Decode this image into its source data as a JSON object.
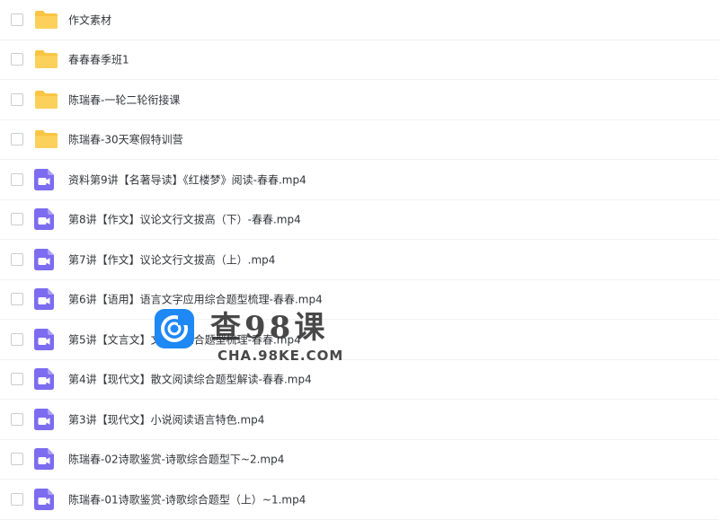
{
  "files": [
    {
      "type": "folder",
      "name": "作文素材"
    },
    {
      "type": "folder",
      "name": "春春春季班1"
    },
    {
      "type": "folder",
      "name": "陈瑞春-一轮二轮衔接课"
    },
    {
      "type": "folder",
      "name": "陈瑞春-30天寒假特训营"
    },
    {
      "type": "video",
      "name": "资料第9讲【名著导读】《红楼梦》阅读-春春.mp4"
    },
    {
      "type": "video",
      "name": "第8讲【作文】议论文行文拔高（下）-春春.mp4"
    },
    {
      "type": "video",
      "name": "第7讲【作文】议论文行文拔高（上）.mp4"
    },
    {
      "type": "video",
      "name": "第6讲【语用】语言文字应用综合题型梳理-春春.mp4"
    },
    {
      "type": "video",
      "name": "第5讲【文言文】文言文综合题型梳理-春春.mp4"
    },
    {
      "type": "video",
      "name": "第4讲【现代文】散文阅读综合题型解读-春春.mp4"
    },
    {
      "type": "video",
      "name": "第3讲【现代文】小说阅读语言特色.mp4"
    },
    {
      "type": "video",
      "name": "陈瑞春-02诗歌鉴赏-诗歌综合题型下~2.mp4"
    },
    {
      "type": "video",
      "name": "陈瑞春-01诗歌鉴赏-诗歌综合题型（上）~1.mp4"
    }
  ],
  "icons": {
    "folder": "folder-icon",
    "video": "video-file-icon"
  },
  "colors": {
    "folder": "#f9c543",
    "video": "#7c6cf0",
    "watermark_blue": "#1e88f5"
  },
  "watermark": {
    "title": "查98课",
    "subtitle": "CHA.98KE.COM"
  }
}
